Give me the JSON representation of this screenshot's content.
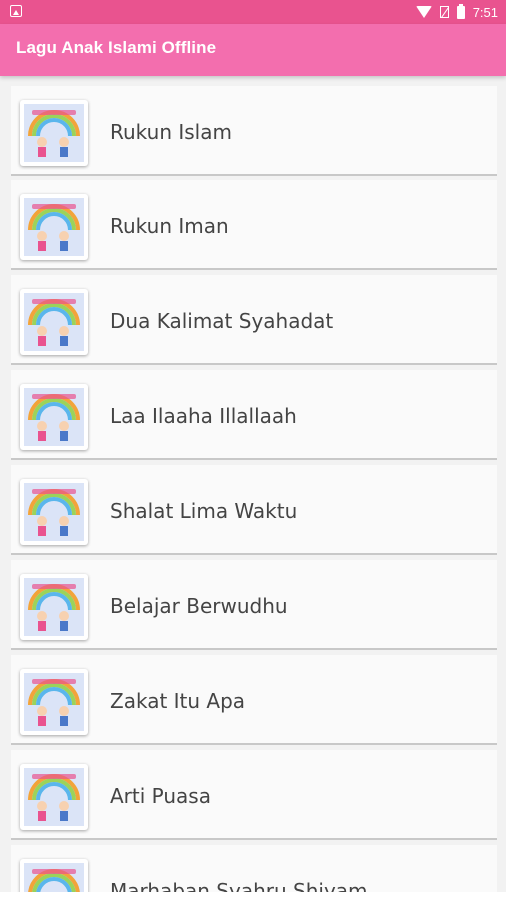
{
  "status_bar": {
    "time": "7:51",
    "icons": [
      "image-notification-icon",
      "wifi-icon",
      "no-sim-icon",
      "battery-icon"
    ]
  },
  "app_bar": {
    "title": "Lagu Anak Islami Offline",
    "color": "#f36eae"
  },
  "list": {
    "items": [
      {
        "label": "Rukun Islam",
        "icon": "app-thumbnail-icon"
      },
      {
        "label": "Rukun Iman",
        "icon": "app-thumbnail-icon"
      },
      {
        "label": "Dua Kalimat Syahadat",
        "icon": "app-thumbnail-icon"
      },
      {
        "label": "Laa Ilaaha Illallaah",
        "icon": "app-thumbnail-icon"
      },
      {
        "label": "Shalat Lima Waktu",
        "icon": "app-thumbnail-icon"
      },
      {
        "label": "Belajar Berwudhu",
        "icon": "app-thumbnail-icon"
      },
      {
        "label": "Zakat Itu Apa",
        "icon": "app-thumbnail-icon"
      },
      {
        "label": "Arti Puasa",
        "icon": "app-thumbnail-icon"
      },
      {
        "label": "Marhaban Syahru Shiyam",
        "icon": "app-thumbnail-icon"
      }
    ]
  },
  "colors": {
    "status_bar": "#e9538f",
    "background": "#f2f2f2",
    "text": "#444444"
  }
}
